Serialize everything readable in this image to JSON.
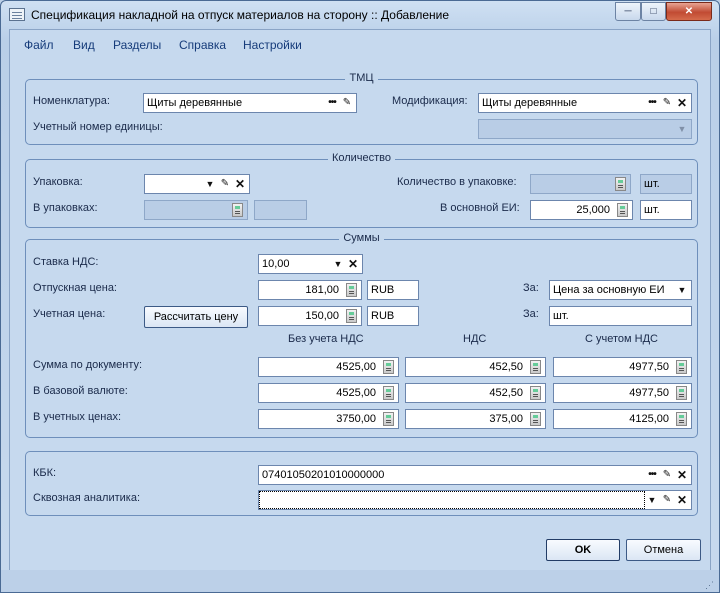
{
  "window": {
    "title": "Спецификация накладной на отпуск материалов на сторону :: Добавление",
    "minimize": "─",
    "maximize": "□",
    "close": "✕"
  },
  "menu": [
    "Файл",
    "Вид",
    "Разделы",
    "Справка",
    "Настройки"
  ],
  "tmc": {
    "title": "ТМЦ",
    "nomenclature_label": "Номенклатура:",
    "nomenclature_value": "Щиты деревянные",
    "modification_label": "Модификация:",
    "modification_value": "Щиты деревянные",
    "unit_account_label": "Учетный номер единицы:",
    "unit_account_value": ""
  },
  "quantity": {
    "title": "Количество",
    "package_label": "Упаковка:",
    "package_value": "",
    "qty_in_package_label": "Количество в упаковке:",
    "qty_in_package_value": "",
    "qty_in_package_unit": "шт.",
    "in_packages_label": "В упаковках:",
    "in_packages_value": "",
    "in_packages_extra": "",
    "base_unit_label": "В основной ЕИ:",
    "base_unit_value": "25,000",
    "base_unit_unit": "шт."
  },
  "sums": {
    "title": "Суммы",
    "vat_rate_label": "Ставка НДС:",
    "vat_rate_value": "10,00",
    "release_price_label": "Отпускная цена:",
    "release_price_value": "181,00",
    "release_price_currency": "RUB",
    "for_label_1": "За:",
    "for_value_1": "Цена за основную ЕИ",
    "account_price_label": "Учетная цена:",
    "calc_price_button": "Рассчитать цену",
    "account_price_value": "150,00",
    "account_price_currency": "RUB",
    "for_label_2": "За:",
    "for_value_2": "шт.",
    "columns": [
      "Без учета НДС",
      "НДС",
      "С учетом НДС"
    ],
    "rows": [
      {
        "label": "Сумма по документу:",
        "values": [
          "4525,00",
          "452,50",
          "4977,50"
        ]
      },
      {
        "label": "В базовой валюте:",
        "values": [
          "4525,00",
          "452,50",
          "4977,50"
        ]
      },
      {
        "label": "В учетных ценах:",
        "values": [
          "3750,00",
          "375,00",
          "4125,00"
        ]
      }
    ]
  },
  "extra": {
    "kbk_label": "КБК:",
    "kbk_value": "07401050201010000000",
    "analytics_label": "Сквозная аналитика:",
    "analytics_value": ""
  },
  "buttons": {
    "ok": "OK",
    "cancel": "Отмена"
  },
  "icons": {
    "dots": "•••",
    "edit": "✎",
    "clear": "✕",
    "dropdown": "▼"
  }
}
